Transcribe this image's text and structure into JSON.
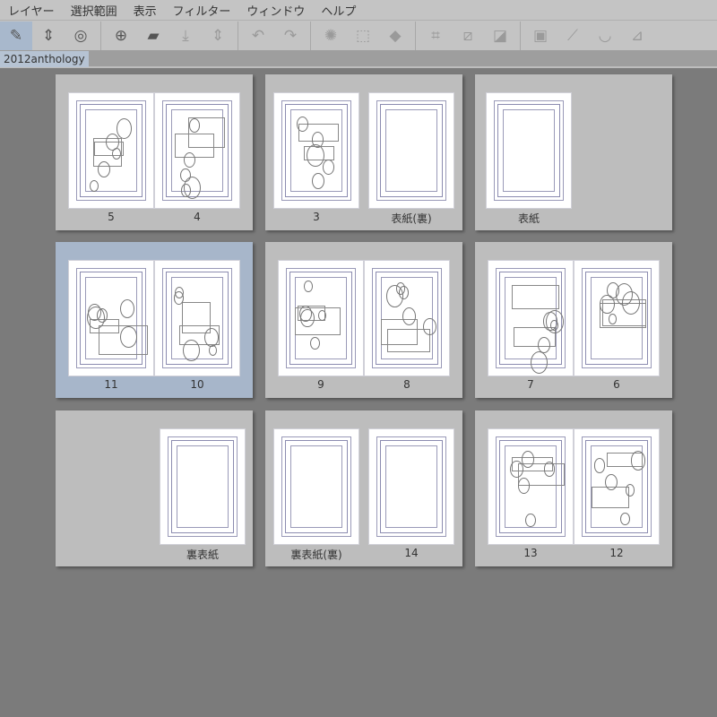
{
  "menu": [
    "レイヤー",
    "選択範囲",
    "表示",
    "フィルター",
    "ウィンドウ",
    "ヘルプ"
  ],
  "toolbar": {
    "icons": [
      "edit-layer-icon",
      "up-down-icon",
      "lasso-icon",
      "new-page-icon",
      "open-folder-icon",
      "save-icon",
      "up-down-icon",
      "undo-icon",
      "redo-icon",
      "loading-icon",
      "selection-icon",
      "fill-icon",
      "transform-icon",
      "deselect-icon",
      "invert-selection-icon",
      "border-selection-icon",
      "ruler-icon",
      "curve-ruler-icon",
      "perspective-ruler-icon"
    ]
  },
  "tab": {
    "title": "2012anthology"
  },
  "groups": [
    {
      "type": "spread",
      "pages": [
        {
          "label": "5",
          "sketch": true
        },
        {
          "label": "4",
          "sketch": true
        }
      ]
    },
    {
      "type": "pair",
      "pages": [
        {
          "label": "3",
          "sketch": true
        },
        {
          "label": "表紙(裏)",
          "sketch": false
        }
      ]
    },
    {
      "type": "left",
      "pages": [
        {
          "label": "表紙",
          "sketch": false
        }
      ]
    },
    {
      "type": "spread",
      "selected": true,
      "pages": [
        {
          "label": "11",
          "sketch": true
        },
        {
          "label": "10",
          "sketch": true
        }
      ]
    },
    {
      "type": "spread",
      "pages": [
        {
          "label": "9",
          "sketch": true
        },
        {
          "label": "8",
          "sketch": true
        }
      ]
    },
    {
      "type": "spread",
      "pages": [
        {
          "label": "7",
          "sketch": true
        },
        {
          "label": "6",
          "sketch": true
        }
      ]
    },
    {
      "type": "right",
      "pages": [
        {
          "label": "裏表紙",
          "sketch": false
        }
      ]
    },
    {
      "type": "pair",
      "pages": [
        {
          "label": "裏表紙(裏)",
          "sketch": false
        },
        {
          "label": "14",
          "sketch": false
        }
      ]
    },
    {
      "type": "spread",
      "pages": [
        {
          "label": "13",
          "sketch": true
        },
        {
          "label": "12",
          "sketch": true
        }
      ]
    }
  ]
}
